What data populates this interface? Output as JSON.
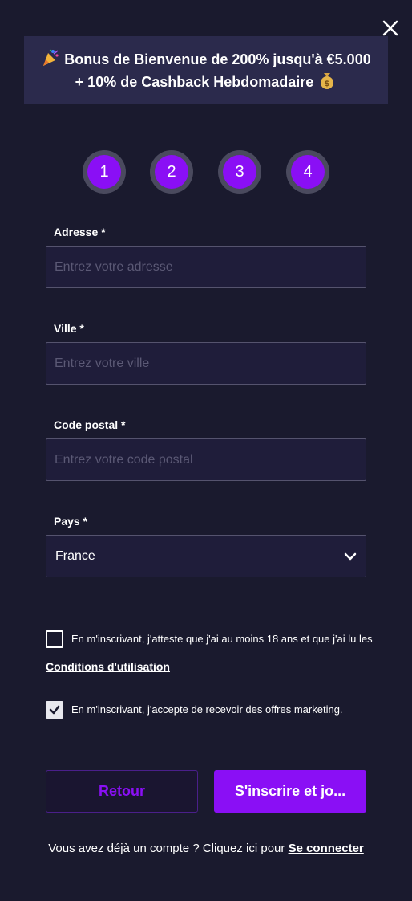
{
  "banner": {
    "party_icon": "party-popper-icon",
    "line1": "Bonus de Bienvenue de 200% jusqu'à €5.000",
    "line2": "+ 10% de Cashback Hebdomadaire",
    "money_icon": "money-bag-icon"
  },
  "steps": [
    "1",
    "2",
    "3",
    "4"
  ],
  "fields": {
    "address": {
      "label": "Adresse *",
      "placeholder": "Entrez votre adresse",
      "value": ""
    },
    "city": {
      "label": "Ville *",
      "placeholder": "Entrez votre ville",
      "value": ""
    },
    "postal": {
      "label": "Code postal *",
      "placeholder": "Entrez votre code postal",
      "value": ""
    },
    "country": {
      "label": "Pays *",
      "value": "France"
    }
  },
  "consent": {
    "terms_text": "En m'inscrivant, j'atteste que j'ai au moins 18 ans et que j'ai lu les",
    "terms_link": "Conditions d'utilisation",
    "terms_checked": false,
    "marketing_text": "En m'inscrivant, j'accepte de recevoir des offres marketing.",
    "marketing_checked": true
  },
  "buttons": {
    "back": "Retour",
    "submit": "S'inscrire et jo..."
  },
  "footer": {
    "text": "Vous avez déjà un compte ? Cliquez ici pour",
    "link": "Se connecter"
  },
  "colors": {
    "background": "#1a1a2e",
    "banner": "#2b2a4c",
    "accent": "#8a0ff5",
    "input_bg": "#1f1d3a"
  }
}
